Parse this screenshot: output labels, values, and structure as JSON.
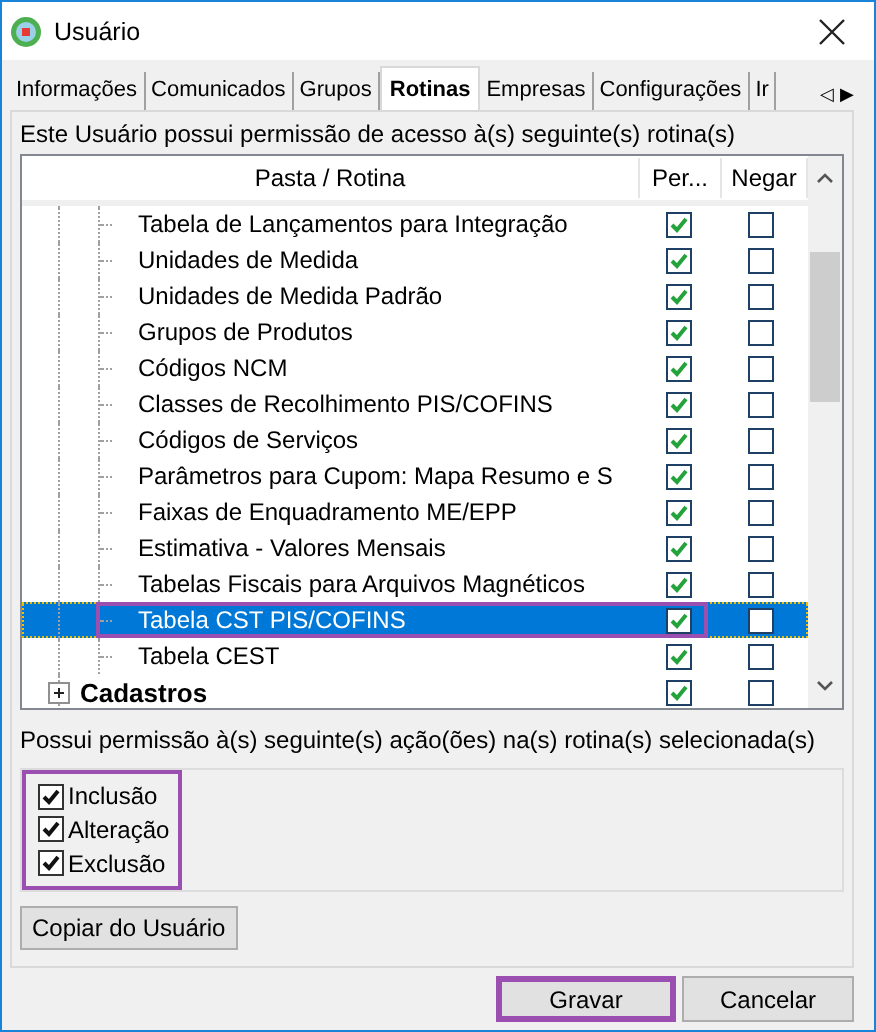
{
  "window": {
    "title": "Usuário"
  },
  "tabs": [
    {
      "label": "Informações",
      "selected": false
    },
    {
      "label": "Comunicados",
      "selected": false
    },
    {
      "label": "Grupos",
      "selected": false
    },
    {
      "label": "Rotinas",
      "selected": true
    },
    {
      "label": "Empresas",
      "selected": false
    },
    {
      "label": "Configurações",
      "selected": false
    },
    {
      "label": "Ir",
      "selected": false
    }
  ],
  "tab_scroll": {
    "left": "◁",
    "right": "▶"
  },
  "routines_caption": "Este Usuário possui permissão de acesso à(s) seguinte(s) rotina(s)",
  "table": {
    "columns": [
      "Pasta / Rotina",
      "Per...",
      "Negar"
    ],
    "tree": [
      {
        "children": [
          {
            "label": "Tabela de Lançamentos para Integração",
            "permit": true,
            "deny": false,
            "selected": false,
            "highlighted": false
          },
          {
            "label": "Unidades de Medida",
            "permit": true,
            "deny": false,
            "selected": false,
            "highlighted": false
          },
          {
            "label": "Unidades de Medida Padrão",
            "permit": true,
            "deny": false,
            "selected": false,
            "highlighted": false
          },
          {
            "label": "Grupos de Produtos",
            "permit": true,
            "deny": false,
            "selected": false,
            "highlighted": false
          },
          {
            "label": "Códigos NCM",
            "permit": true,
            "deny": false,
            "selected": false,
            "highlighted": false
          },
          {
            "label": "Classes de Recolhimento PIS/COFINS",
            "permit": true,
            "deny": false,
            "selected": false,
            "highlighted": false
          },
          {
            "label": "Códigos de Serviços",
            "permit": true,
            "deny": false,
            "selected": false,
            "highlighted": false
          },
          {
            "label": "Parâmetros para Cupom: Mapa Resumo e S",
            "permit": true,
            "deny": false,
            "selected": false,
            "highlighted": false
          },
          {
            "label": "Faixas de Enquadramento ME/EPP",
            "permit": true,
            "deny": false,
            "selected": false,
            "highlighted": false
          },
          {
            "label": "Estimativa - Valores Mensais",
            "permit": true,
            "deny": false,
            "selected": false,
            "highlighted": false
          },
          {
            "label": "Tabelas Fiscais para Arquivos Magnéticos",
            "permit": true,
            "deny": false,
            "selected": false,
            "highlighted": false
          },
          {
            "label": "Tabela CST PIS/COFINS",
            "permit": true,
            "deny": false,
            "selected": true,
            "highlighted": true
          },
          {
            "label": "Tabela CEST",
            "permit": true,
            "deny": false,
            "selected": false,
            "highlighted": false
          }
        ]
      },
      {
        "label": "Cadastros",
        "expanded": false,
        "permit": true,
        "deny": false,
        "selected": false,
        "highlighted": false
      }
    ]
  },
  "actions_caption": "Possui permissão à(s) seguinte(s) ação(ões) na(s) rotina(s) selecionada(s)",
  "actions": {
    "highlighted": true,
    "items": [
      {
        "label": "Inclusão",
        "checked": true
      },
      {
        "label": "Alteração",
        "checked": true
      },
      {
        "label": "Exclusão",
        "checked": true
      }
    ]
  },
  "copy_button": "Copiar do Usuário",
  "buttons": [
    {
      "label": "Gravar",
      "highlighted": true
    },
    {
      "label": "Cancelar",
      "highlighted": false
    }
  ]
}
